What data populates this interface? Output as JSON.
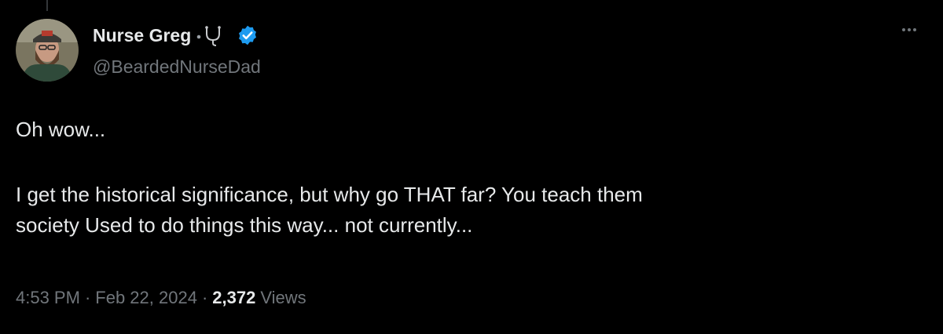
{
  "author": {
    "display_name": "Nurse Greg",
    "handle": "@BeardedNurseDad",
    "emoji_icons": [
      "dot-icon",
      "stethoscope-icon"
    ],
    "verified_icon": "verified-badge-icon",
    "verified_color": "#1d9bf0"
  },
  "tweet": {
    "paragraphs": [
      "Oh wow...",
      "I get the historical significance, but why go THAT far? You teach them\nsociety Used to do things this way... not currently..."
    ]
  },
  "meta": {
    "time": "4:53 PM",
    "separator": "·",
    "date": "Feb 22, 2024",
    "views_count": "2,372",
    "views_label": "Views"
  },
  "colors": {
    "background": "#000000",
    "primary_text": "#e7e9ea",
    "secondary_text": "#71767b"
  }
}
